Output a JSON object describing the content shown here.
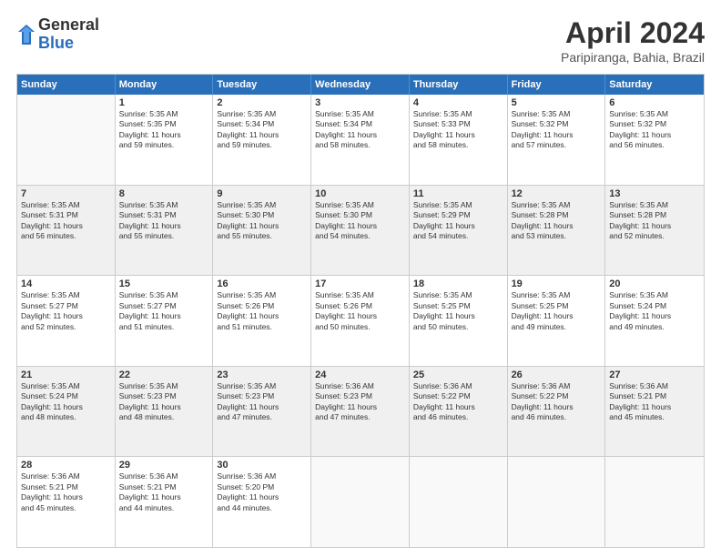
{
  "header": {
    "logo_general": "General",
    "logo_blue": "Blue",
    "title": "April 2024",
    "location": "Paripiranga, Bahia, Brazil"
  },
  "days_of_week": [
    "Sunday",
    "Monday",
    "Tuesday",
    "Wednesday",
    "Thursday",
    "Friday",
    "Saturday"
  ],
  "weeks": [
    [
      {
        "day": "",
        "info": ""
      },
      {
        "day": "1",
        "info": "Sunrise: 5:35 AM\nSunset: 5:35 PM\nDaylight: 11 hours\nand 59 minutes."
      },
      {
        "day": "2",
        "info": "Sunrise: 5:35 AM\nSunset: 5:34 PM\nDaylight: 11 hours\nand 59 minutes."
      },
      {
        "day": "3",
        "info": "Sunrise: 5:35 AM\nSunset: 5:34 PM\nDaylight: 11 hours\nand 58 minutes."
      },
      {
        "day": "4",
        "info": "Sunrise: 5:35 AM\nSunset: 5:33 PM\nDaylight: 11 hours\nand 58 minutes."
      },
      {
        "day": "5",
        "info": "Sunrise: 5:35 AM\nSunset: 5:32 PM\nDaylight: 11 hours\nand 57 minutes."
      },
      {
        "day": "6",
        "info": "Sunrise: 5:35 AM\nSunset: 5:32 PM\nDaylight: 11 hours\nand 56 minutes."
      }
    ],
    [
      {
        "day": "7",
        "info": "Sunrise: 5:35 AM\nSunset: 5:31 PM\nDaylight: 11 hours\nand 56 minutes."
      },
      {
        "day": "8",
        "info": "Sunrise: 5:35 AM\nSunset: 5:31 PM\nDaylight: 11 hours\nand 55 minutes."
      },
      {
        "day": "9",
        "info": "Sunrise: 5:35 AM\nSunset: 5:30 PM\nDaylight: 11 hours\nand 55 minutes."
      },
      {
        "day": "10",
        "info": "Sunrise: 5:35 AM\nSunset: 5:30 PM\nDaylight: 11 hours\nand 54 minutes."
      },
      {
        "day": "11",
        "info": "Sunrise: 5:35 AM\nSunset: 5:29 PM\nDaylight: 11 hours\nand 54 minutes."
      },
      {
        "day": "12",
        "info": "Sunrise: 5:35 AM\nSunset: 5:28 PM\nDaylight: 11 hours\nand 53 minutes."
      },
      {
        "day": "13",
        "info": "Sunrise: 5:35 AM\nSunset: 5:28 PM\nDaylight: 11 hours\nand 52 minutes."
      }
    ],
    [
      {
        "day": "14",
        "info": "Sunrise: 5:35 AM\nSunset: 5:27 PM\nDaylight: 11 hours\nand 52 minutes."
      },
      {
        "day": "15",
        "info": "Sunrise: 5:35 AM\nSunset: 5:27 PM\nDaylight: 11 hours\nand 51 minutes."
      },
      {
        "day": "16",
        "info": "Sunrise: 5:35 AM\nSunset: 5:26 PM\nDaylight: 11 hours\nand 51 minutes."
      },
      {
        "day": "17",
        "info": "Sunrise: 5:35 AM\nSunset: 5:26 PM\nDaylight: 11 hours\nand 50 minutes."
      },
      {
        "day": "18",
        "info": "Sunrise: 5:35 AM\nSunset: 5:25 PM\nDaylight: 11 hours\nand 50 minutes."
      },
      {
        "day": "19",
        "info": "Sunrise: 5:35 AM\nSunset: 5:25 PM\nDaylight: 11 hours\nand 49 minutes."
      },
      {
        "day": "20",
        "info": "Sunrise: 5:35 AM\nSunset: 5:24 PM\nDaylight: 11 hours\nand 49 minutes."
      }
    ],
    [
      {
        "day": "21",
        "info": "Sunrise: 5:35 AM\nSunset: 5:24 PM\nDaylight: 11 hours\nand 48 minutes."
      },
      {
        "day": "22",
        "info": "Sunrise: 5:35 AM\nSunset: 5:23 PM\nDaylight: 11 hours\nand 48 minutes."
      },
      {
        "day": "23",
        "info": "Sunrise: 5:35 AM\nSunset: 5:23 PM\nDaylight: 11 hours\nand 47 minutes."
      },
      {
        "day": "24",
        "info": "Sunrise: 5:36 AM\nSunset: 5:23 PM\nDaylight: 11 hours\nand 47 minutes."
      },
      {
        "day": "25",
        "info": "Sunrise: 5:36 AM\nSunset: 5:22 PM\nDaylight: 11 hours\nand 46 minutes."
      },
      {
        "day": "26",
        "info": "Sunrise: 5:36 AM\nSunset: 5:22 PM\nDaylight: 11 hours\nand 46 minutes."
      },
      {
        "day": "27",
        "info": "Sunrise: 5:36 AM\nSunset: 5:21 PM\nDaylight: 11 hours\nand 45 minutes."
      }
    ],
    [
      {
        "day": "28",
        "info": "Sunrise: 5:36 AM\nSunset: 5:21 PM\nDaylight: 11 hours\nand 45 minutes."
      },
      {
        "day": "29",
        "info": "Sunrise: 5:36 AM\nSunset: 5:21 PM\nDaylight: 11 hours\nand 44 minutes."
      },
      {
        "day": "30",
        "info": "Sunrise: 5:36 AM\nSunset: 5:20 PM\nDaylight: 11 hours\nand 44 minutes."
      },
      {
        "day": "",
        "info": ""
      },
      {
        "day": "",
        "info": ""
      },
      {
        "day": "",
        "info": ""
      },
      {
        "day": "",
        "info": ""
      }
    ]
  ]
}
